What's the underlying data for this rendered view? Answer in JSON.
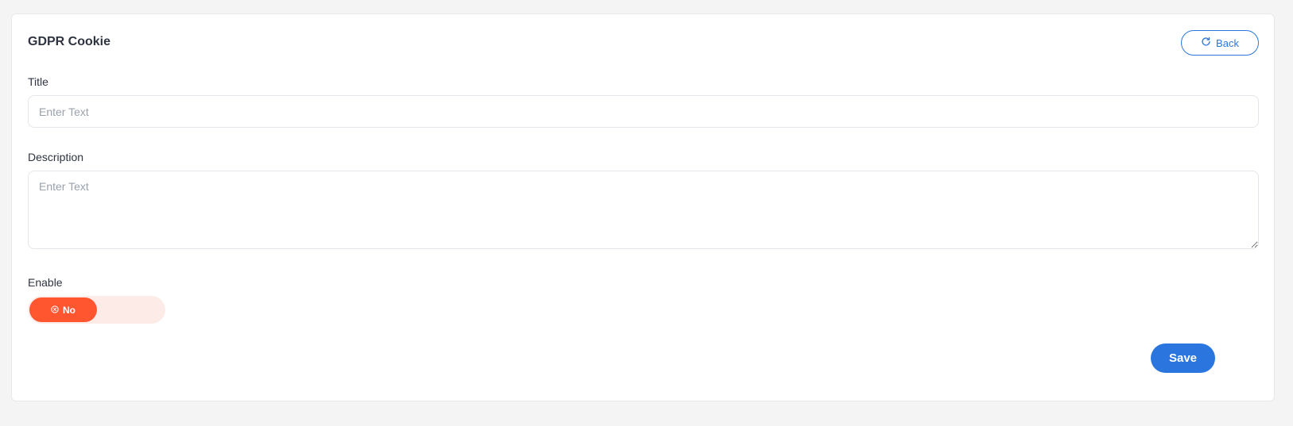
{
  "header": {
    "title": "GDPR Cookie",
    "back_label": "Back"
  },
  "form": {
    "title_label": "Title",
    "title_placeholder": "Enter Text",
    "title_value": "",
    "description_label": "Description",
    "description_placeholder": "Enter Text",
    "description_value": "",
    "enable_label": "Enable",
    "enable_state_label": "No",
    "enable_value": false
  },
  "actions": {
    "save_label": "Save"
  },
  "colors": {
    "primary": "#2a76de",
    "toggle_off": "#ff5630",
    "toggle_track": "#fdebe8",
    "background": "#f3f4f3"
  },
  "icons": {
    "back": "refresh-icon",
    "toggle": "close-circle-icon"
  }
}
